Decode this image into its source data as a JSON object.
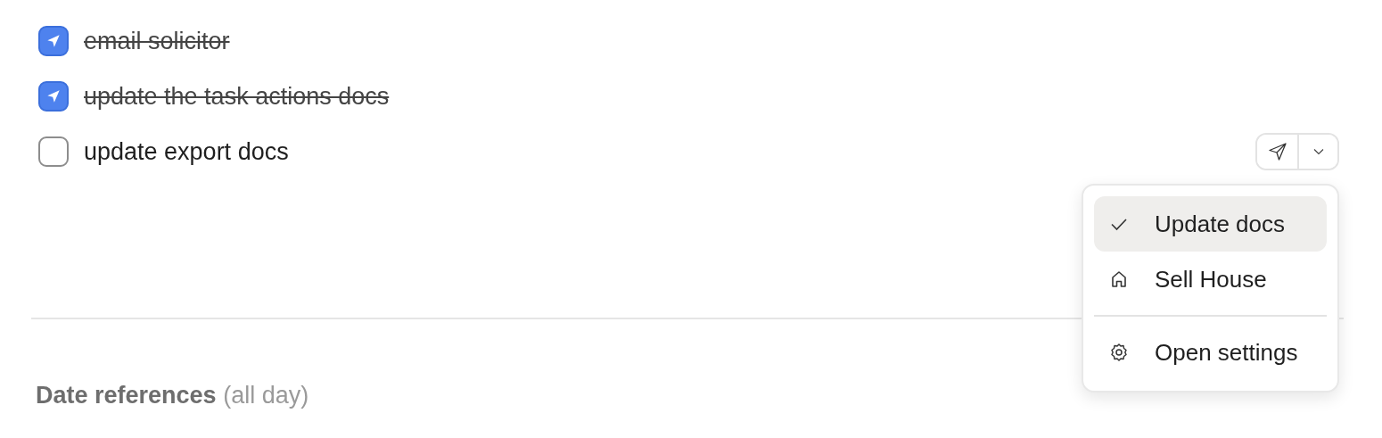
{
  "tasks": [
    {
      "text": "email solicitor",
      "checked": true
    },
    {
      "text": "update the task actions docs",
      "checked": true
    },
    {
      "text": "update export docs",
      "checked": false
    }
  ],
  "menu": {
    "sections": [
      {
        "items": [
          {
            "label": "Update docs",
            "kind": "check",
            "selected": true
          },
          {
            "label": "Sell House",
            "kind": "home",
            "selected": false
          }
        ]
      },
      {
        "items": [
          {
            "label": "Open settings",
            "kind": "gear",
            "selected": false
          }
        ]
      }
    ]
  },
  "section_heading": {
    "title": "Date references",
    "note": "(all day)"
  }
}
